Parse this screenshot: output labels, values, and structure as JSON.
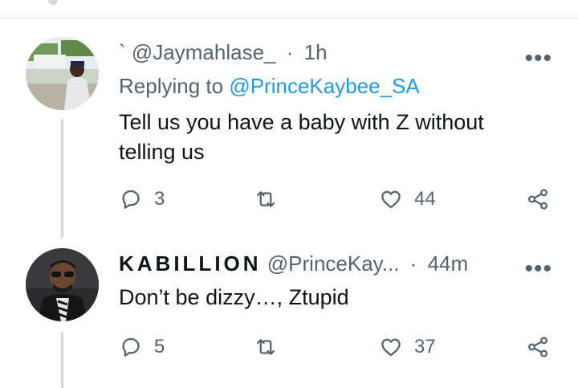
{
  "tweets": [
    {
      "user_prefix": "`",
      "display_name": "",
      "handle": "@Jaymahlase_",
      "time": "1h",
      "replying_to_label": "Replying to",
      "replying_to_handle": "@PrinceKaybee_SA",
      "text": "Tell us you have a baby with Z without telling us",
      "replies": "3",
      "retweets": "",
      "likes": "44",
      "more_label": "•••"
    },
    {
      "display_name": "KABILLION",
      "handle": "@PrinceKay...",
      "time": "44m",
      "text": "Don’t be dizzy…, Ztupid",
      "replies": "5",
      "retweets": "",
      "likes": "37",
      "more_label": "•••"
    }
  ],
  "separator": "·",
  "icons": {
    "reply": "reply-icon",
    "retweet": "retweet-icon",
    "like": "heart-icon",
    "share": "share-icon",
    "more": "more-icon"
  },
  "colors": {
    "link": "#1d9bf0",
    "muted": "#536471",
    "text": "#0f1419",
    "thread": "#cfd9de"
  }
}
